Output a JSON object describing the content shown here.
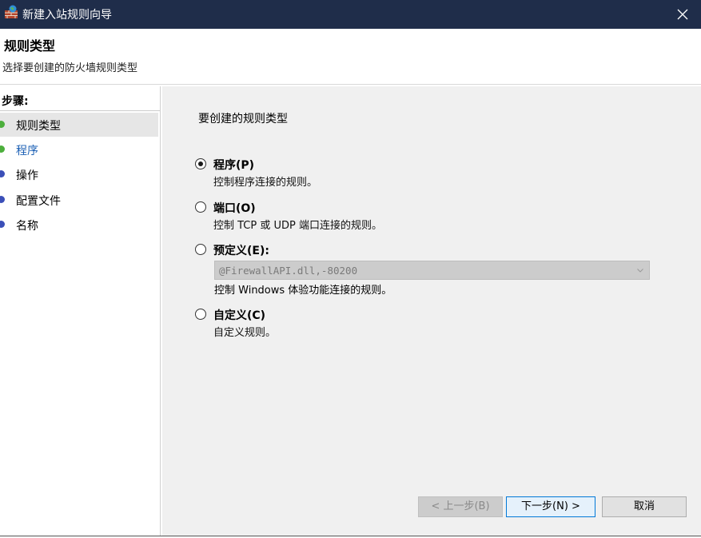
{
  "window": {
    "title": "新建入站规则向导",
    "app_icon": "firewall-brick-globe-icon",
    "close_icon": "close-icon"
  },
  "header": {
    "title": "规则类型",
    "subtitle": "选择要创建的防火墙规则类型"
  },
  "steps": {
    "heading": "步骤:",
    "items": [
      {
        "label": "规则类型",
        "status": "done",
        "dot_color": "#4caf3c"
      },
      {
        "label": "程序",
        "status": "done",
        "dot_color": "#4caf3c"
      },
      {
        "label": "操作",
        "status": "pending",
        "dot_color": "#3b4fb8"
      },
      {
        "label": "配置文件",
        "status": "pending",
        "dot_color": "#3b4fb8"
      },
      {
        "label": "名称",
        "status": "pending",
        "dot_color": "#3b4fb8"
      }
    ]
  },
  "main": {
    "question": "要创建的规则类型",
    "options": [
      {
        "label": "程序(P)",
        "desc": "控制程序连接的规则。",
        "checked": true
      },
      {
        "label": "端口(O)",
        "desc": "控制 TCP 或 UDP 端口连接的规则。",
        "checked": false
      },
      {
        "label": "预定义(E):",
        "desc": "",
        "checked": false
      },
      {
        "label": "自定义(C)",
        "desc": "自定义规则。",
        "checked": false
      }
    ],
    "predefined_combo": {
      "value": "@FirewallAPI.dll,-80200",
      "disabled": true
    },
    "predefined_desc": "控制 Windows 体验功能连接的规则。"
  },
  "buttons": {
    "back": "< 上一步(B)",
    "next": "下一步(N) >",
    "cancel": "取消"
  },
  "colors": {
    "titlebar": "#1f2d4a",
    "accent": "#0078d7",
    "panel_bg": "#f0f0f0"
  }
}
